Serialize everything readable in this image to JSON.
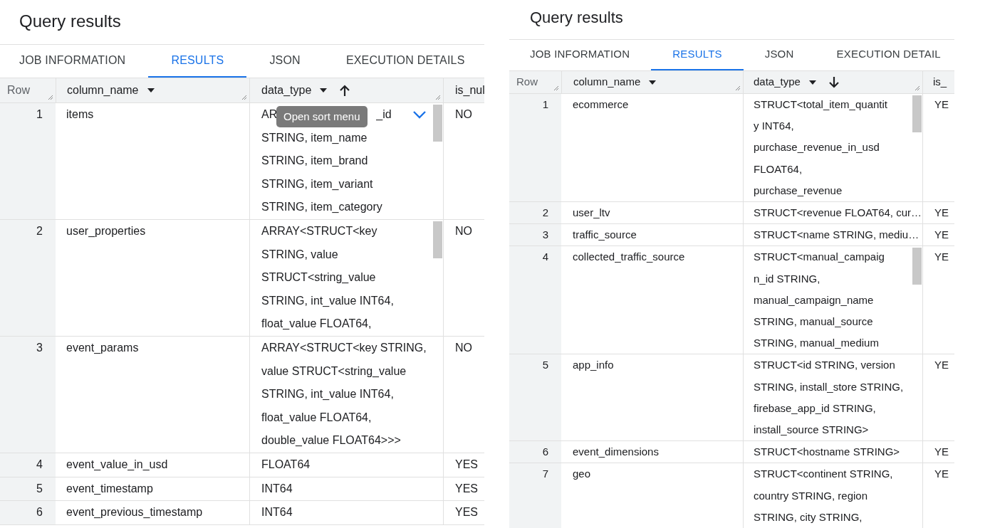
{
  "panels": [
    {
      "title": "Query results",
      "tabs": [
        {
          "label": "JOB INFORMATION",
          "selected": false
        },
        {
          "label": "RESULTS",
          "selected": true
        },
        {
          "label": "JSON",
          "selected": false
        },
        {
          "label": "EXECUTION DETAILS",
          "selected": false
        }
      ],
      "columns": [
        {
          "label": "Row",
          "menu": false
        },
        {
          "label": "column_name",
          "menu": true
        },
        {
          "label": "data_type",
          "menu": true,
          "sorted": true,
          "sort_ascending": true
        },
        {
          "label": "is_nul",
          "menu": false
        }
      ],
      "tooltip": "Open sort menu",
      "rows": [
        {
          "row": "1",
          "column_name": "items",
          "data_type": [
            [
              "AR",
              "_id"
            ],
            "STRING, item_name",
            "STRING, item_brand",
            "STRING, item_variant",
            "STRING, item_category"
          ],
          "is_nullable": "NO",
          "scrollbar": true,
          "expand": true
        },
        {
          "row": "2",
          "column_name": "user_properties",
          "data_type": [
            "ARRAY<STRUCT<key",
            "STRING, value",
            "STRUCT<string_value",
            "STRING, int_value INT64,",
            "float_value FLOAT64,"
          ],
          "is_nullable": "NO",
          "scrollbar": true,
          "expand": false
        },
        {
          "row": "3",
          "column_name": "event_params",
          "data_type": [
            "ARRAY<STRUCT<key STRING,",
            "value STRUCT<string_value",
            "STRING, int_value INT64,",
            "float_value FLOAT64,",
            "double_value FLOAT64>>>"
          ],
          "is_nullable": "NO",
          "scrollbar": false,
          "expand": false
        },
        {
          "row": "4",
          "column_name": "event_value_in_usd",
          "data_type": [
            "FLOAT64"
          ],
          "is_nullable": "YES",
          "scrollbar": false,
          "expand": false
        },
        {
          "row": "5",
          "column_name": "event_timestamp",
          "data_type": [
            "INT64"
          ],
          "is_nullable": "YES",
          "scrollbar": false,
          "expand": false
        },
        {
          "row": "6",
          "column_name": "event_previous_timestamp",
          "data_type": [
            "INT64"
          ],
          "is_nullable": "YES",
          "scrollbar": false,
          "expand": false
        }
      ]
    },
    {
      "title": "Query results",
      "tabs": [
        {
          "label": "JOB INFORMATION",
          "selected": false
        },
        {
          "label": "RESULTS",
          "selected": true
        },
        {
          "label": "JSON",
          "selected": false
        },
        {
          "label": "EXECUTION DETAIL",
          "selected": false
        }
      ],
      "columns": [
        {
          "label": "Row",
          "menu": false
        },
        {
          "label": "column_name",
          "menu": true
        },
        {
          "label": "data_type",
          "menu": true,
          "sorted": true,
          "sort_ascending": false
        },
        {
          "label": "is_",
          "menu": false
        }
      ],
      "rows": [
        {
          "row": "1",
          "column_name": "ecommerce",
          "data_type": [
            "STRUCT<total_item_quantit",
            "y INT64,",
            "purchase_revenue_in_usd",
            "FLOAT64,",
            "purchase_revenue"
          ],
          "is_nullable": "YE",
          "scrollbar": true,
          "expand": false
        },
        {
          "row": "2",
          "column_name": "user_ltv",
          "data_type": [
            "STRUCT<revenue FLOAT64, cur…"
          ],
          "is_nullable": "YE",
          "scrollbar": false,
          "expand": false
        },
        {
          "row": "3",
          "column_name": "traffic_source",
          "data_type": [
            "STRUCT<name STRING, mediu…"
          ],
          "is_nullable": "YE",
          "scrollbar": false,
          "expand": false
        },
        {
          "row": "4",
          "column_name": "collected_traffic_source",
          "data_type": [
            "STRUCT<manual_campaig",
            "n_id STRING,",
            "manual_campaign_name",
            "STRING, manual_source",
            "STRING, manual_medium"
          ],
          "is_nullable": "YE",
          "scrollbar": true,
          "expand": false
        },
        {
          "row": "5",
          "column_name": "app_info",
          "data_type": [
            "STRUCT<id STRING, version",
            "STRING, install_store STRING,",
            "firebase_app_id STRING,",
            "install_source STRING>"
          ],
          "is_nullable": "YE",
          "scrollbar": false,
          "expand": false
        },
        {
          "row": "6",
          "column_name": "event_dimensions",
          "data_type": [
            "STRUCT<hostname STRING>"
          ],
          "is_nullable": "YE",
          "scrollbar": false,
          "expand": false
        },
        {
          "row": "7",
          "column_name": "geo",
          "data_type": [
            "STRUCT<continent STRING,",
            "country STRING, region",
            "STRING, city STRING,"
          ],
          "is_nullable": "YE",
          "scrollbar": false,
          "expand": false
        }
      ]
    }
  ]
}
